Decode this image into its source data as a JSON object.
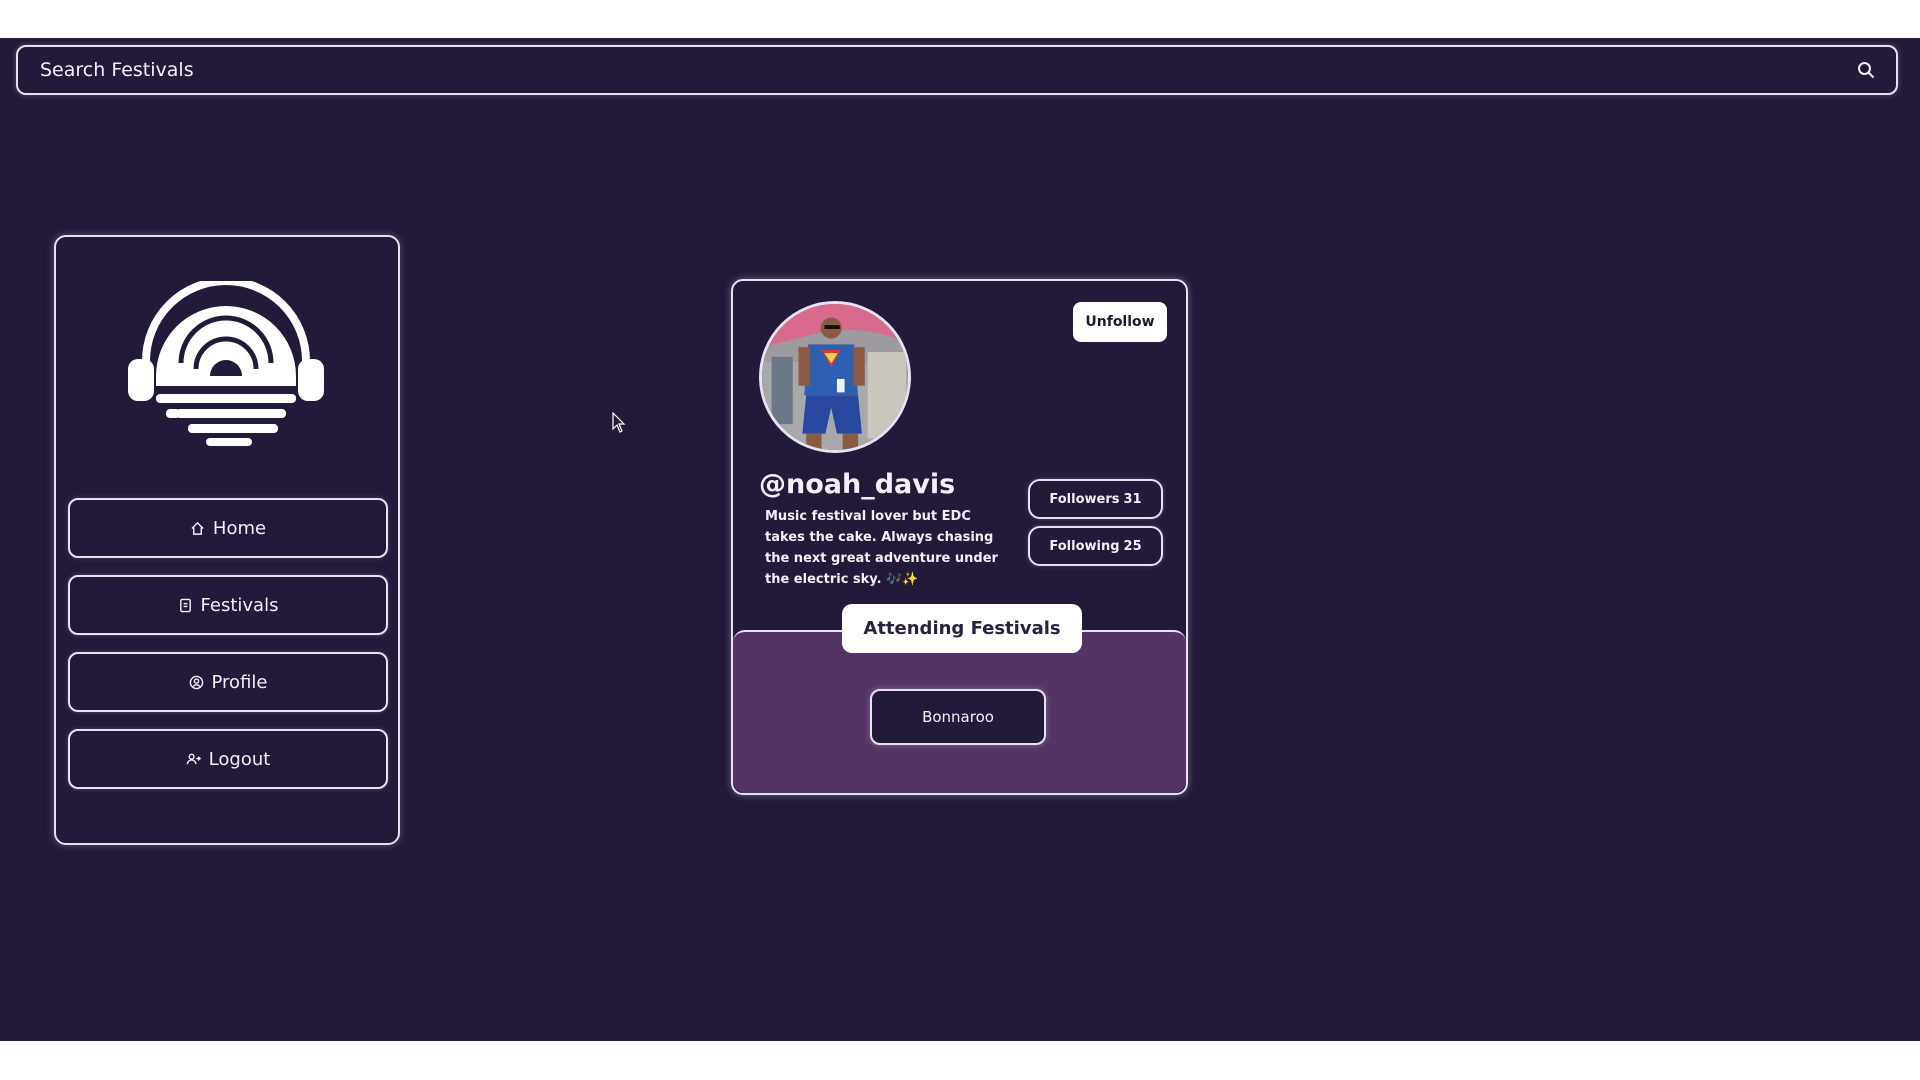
{
  "search": {
    "placeholder": "Search Festivals",
    "icon": "search-icon"
  },
  "sidebar": {
    "logo_icon": "headphones-logo-icon",
    "items": [
      {
        "label": "Home",
        "icon": "home-icon"
      },
      {
        "label": "Festivals",
        "icon": "festival-icon"
      },
      {
        "label": "Profile",
        "icon": "profile-icon"
      },
      {
        "label": "Logout",
        "icon": "logout-icon"
      }
    ]
  },
  "profile": {
    "username": "@noah_davis",
    "bio": "Music festival lover but EDC takes the cake. Always chasing the next great adventure under the electric sky. 🎶✨",
    "unfollow_label": "Unfollow",
    "followers_label": "Followers",
    "followers_count": "31",
    "following_label": "Following",
    "following_count": "25",
    "attending_title": "Attending Festivals",
    "festivals": [
      "Bonnaroo"
    ]
  },
  "colors": {
    "background": "#221a38",
    "panel": "#533565",
    "border": "#e6e2f0"
  }
}
